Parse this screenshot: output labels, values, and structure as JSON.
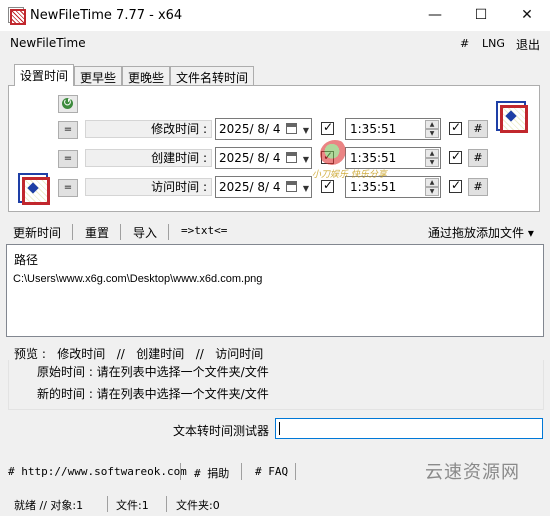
{
  "window": {
    "title": "NewFileTime 7.77 - x64",
    "min_glyph": "—",
    "max_glyph": "☐",
    "close_glyph": "✕"
  },
  "menubar": {
    "app_name": "NewFileTime",
    "hash": "#",
    "lng": "LNG",
    "exit": "退出"
  },
  "tabs": [
    "设置时间",
    "更早些",
    "更晚些",
    "文件名转时间"
  ],
  "time_rows": [
    {
      "eq": "=",
      "label": "修改时间 :",
      "date": "2025/ 8/ 4",
      "time": "1:35:51",
      "hash": "#",
      "date_checked": true,
      "time_checked": true
    },
    {
      "eq": "=",
      "label": "创建时间 :",
      "date": "2025/ 8/ 4",
      "time": "1:35:51",
      "hash": "#",
      "date_checked": true,
      "time_checked": true
    },
    {
      "eq": "=",
      "label": "访问时间 :",
      "date": "2025/ 8/ 4",
      "time": "1:35:51",
      "hash": "#",
      "date_checked": true,
      "time_checked": true
    }
  ],
  "watermark": {
    "text": "小刀娱乐 快乐分享"
  },
  "toolbar": {
    "update": "更新时间",
    "reset": "重置",
    "import": "导入",
    "txt": "=>txt<=",
    "drop": "通过拖放添加文件 ▾"
  },
  "list": {
    "header": "路径",
    "rows": [
      "C:\\Users\\www.x6g.com\\Desktop\\www.x6d.com.png"
    ]
  },
  "preview": {
    "head": "预览 :   修改时间   //   创建时间   //   访问时间",
    "original": "原始时间 : 请在列表中选择一个文件夹/文件",
    "new": "新的时间 : 请在列表中选择一个文件夹/文件"
  },
  "tester": {
    "label": "文本转时间测试器",
    "value": ""
  },
  "footer": {
    "url": "# http://www.softwareok.com",
    "donate": "# 捐助",
    "faq": "# FAQ",
    "brand": "云速资源网"
  },
  "status": {
    "ready": "就绪 // 对象:1",
    "files": "文件:1",
    "folders": "文件夹:0"
  }
}
